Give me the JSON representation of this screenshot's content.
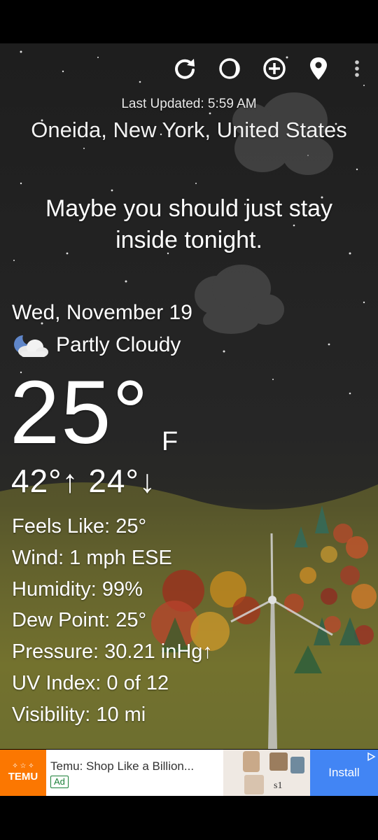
{
  "toolbar": {
    "refresh_icon": "refresh-icon",
    "moon_icon": "moon-phase-icon",
    "add_icon": "add-location-icon",
    "pin_icon": "location-pin-icon",
    "menu_icon": "overflow-menu-icon"
  },
  "header": {
    "last_updated": "Last Updated: 5:59 AM",
    "location": "Oneida, New York, United States"
  },
  "tagline": "Maybe you should just stay inside tonight.",
  "current": {
    "date": "Wed, November 19",
    "condition_icon": "partly-cloudy-night-icon",
    "condition": "Partly Cloudy",
    "temperature": "25°",
    "unit": "F",
    "high_low": "42°↑ 24°↓"
  },
  "details": {
    "feels_like": "Feels Like:  25°",
    "wind": "Wind:  1 mph ESE",
    "humidity": "Humidity:  99%",
    "dew_point": "Dew Point:  25°",
    "pressure": "Pressure:  30.21 inHg↑",
    "uv_index": "UV Index:  0 of 12",
    "visibility": "Visibility:  10 mi"
  },
  "ad": {
    "brand": "TEMU",
    "title": "Temu: Shop Like a Billion...",
    "badge": "Ad",
    "cta": "Install",
    "image_caption": "s1",
    "brand_color": "#fb7701",
    "cta_color": "#4285f4"
  },
  "colors": {
    "sky": "#1e1e1e",
    "ground": "#6b6a2e",
    "text": "#ffffff"
  }
}
